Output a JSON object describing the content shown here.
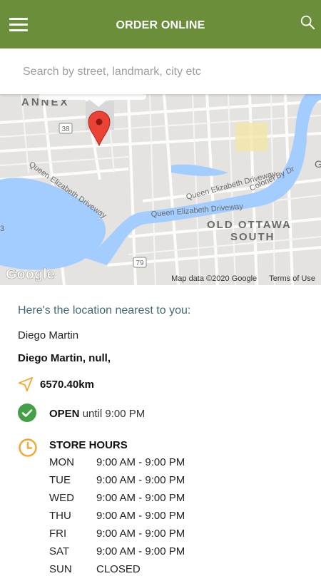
{
  "header": {
    "title": "ORDER ONLINE",
    "menu_icon": "hamburger-menu-icon",
    "search_icon": "search-icon",
    "color": "#6b8e3a"
  },
  "search": {
    "placeholder": "Search by street, landmark, city etc"
  },
  "map": {
    "labels": {
      "annex": "ANNEX",
      "old_ottawa_1": "OLD OTTAWA",
      "old_ottawa_2": "SOUTH",
      "qe_driveway_1": "Queen Elizabeth Driveway",
      "qe_driveway_2": "Queen Elizabeth Driveway",
      "qe_driveway_3": "Queen Elizabeth Driveway",
      "colonel_by": "Colonel By Dr",
      "route_38": "38",
      "route_79": "79",
      "edge_g": "G",
      "edge_3": "3",
      "logo": "Google"
    },
    "data_credit": "Map data ©2020 Google",
    "terms": "Terms of Use",
    "marker_color": "#ea4335",
    "water_color": "#a3ccff",
    "park_color": "#c8e6b4"
  },
  "store": {
    "nearest_label": "Here's the location nearest to you:",
    "name": "Diego Martin",
    "address": "Diego Martin, null,",
    "distance": "6570.40km",
    "status": "OPEN",
    "open_until": "until 9:00 PM",
    "hours_title": "STORE HOURS",
    "hours": [
      {
        "day": "MON",
        "time": "9:00 AM - 9:00 PM"
      },
      {
        "day": "TUE",
        "time": "9:00 AM - 9:00 PM"
      },
      {
        "day": "WED",
        "time": "9:00 AM - 9:00 PM"
      },
      {
        "day": "THU",
        "time": "9:00 AM - 9:00 PM"
      },
      {
        "day": "FRI",
        "time": "9:00 AM - 9:00 PM"
      },
      {
        "day": "SAT",
        "time": "9:00 AM - 9:00 PM"
      },
      {
        "day": "SUN",
        "time": "CLOSED"
      }
    ],
    "accent_color": "#f0a830",
    "check_color": "#43a047"
  }
}
